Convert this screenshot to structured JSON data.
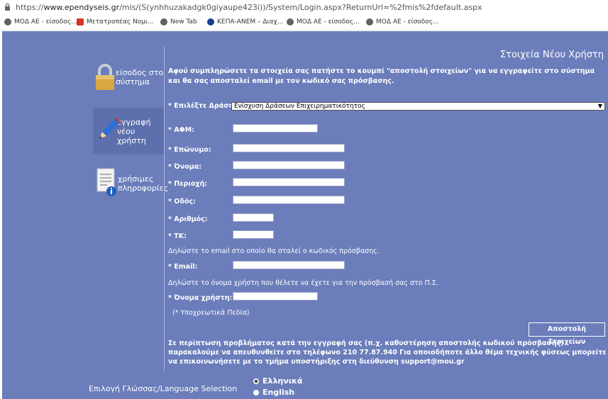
{
  "browser": {
    "url_prefix": "https://",
    "url_domain": "www.ependyseis.gr",
    "url_rest": "/mis/(S(ynhhuzakadgk0giyaupe423i))/System/Login.aspx?ReturnUrl=%2fmis%2fdefault.aspx",
    "bookmarks": [
      {
        "label": "ΜΟΔ ΑΕ - είσοδος...",
        "icon": "globe-icon",
        "color": "#5f6368"
      },
      {
        "label": "Μετατροπέας Νομι...",
        "icon": "app-icon",
        "color": "#d93025"
      },
      {
        "label": "New Tab",
        "icon": "globe-icon",
        "color": "#5f6368"
      },
      {
        "label": "ΚΕΠΑ-ΑΝΕΜ – Διαχ...",
        "icon": "site-icon",
        "color": "#1a3c8f"
      },
      {
        "label": "ΜΟΔ ΑΕ - είσοδος...",
        "icon": "globe-icon",
        "color": "#5f6368"
      },
      {
        "label": "ΜΟΔ ΑΕ - είσοδος...",
        "icon": "globe-icon",
        "color": "#5f6368"
      }
    ]
  },
  "sidebar": {
    "login": {
      "line1": "είσοδος στο",
      "line2": "σύστημα",
      "icon": "padlock-icon"
    },
    "register": {
      "line1": "εγγραφή",
      "line2": "νέου",
      "line3": "χρήστη",
      "icon": "pencil-icon"
    },
    "info": {
      "line1": "χρήσιμες",
      "line2": "πληροφορίες",
      "icon": "info-document-icon"
    }
  },
  "form": {
    "title": "Στοιχεία Νέου Χρήστη",
    "intro": "Αφού συμπληρώσετε τα στοιχεία σας πατήστε το κουμπί \"αποστολή στοιχείων\" για να εγγραφείτε στο σύστημα και θα σας αποσταλεί email με τον κωδικό σας πρόσβασης.",
    "action_label": "* Επιλέξτε Δράση:",
    "action_value": "Ενίσχυση Δράσεων Επιχειρηματικότητος",
    "afm_label": "* ΑΦΜ:",
    "surname_label": "* Επώνυμο:",
    "name_label": "* Όνομα:",
    "region_label": "* Περιοχή:",
    "street_label": "* Οδός:",
    "number_label": "* Αριθμός:",
    "tk_label": "* ΤΚ:",
    "email_note": "Δηλώστε το email στο οποίο θα σταλεί ο κωδικός πρόσβασης.",
    "email_label": "* Email:",
    "username_note": "Δηλώστε το όνομα χρήστη που θέλετε να έχετε για την πρόσβασή σας στο Π.Σ.",
    "username_label": "* Όνομα χρήστη:",
    "required_note": "(*  Υποχρεωτικά Πεδία)",
    "submit_label": "Αποστολή Στοιχείων",
    "help_text": "Σε περίπτωση προβλήματος κατά την εγγραφή σας (π.χ. καθυστέρηση αποστολής κωδικού πρόσβασης) παρακαλούμε να απευθυνθείτε στο τηλέφωνο 210 77.87.940 Για οποιοδήποτε άλλο θέμα τεχνικής φύσεως μπορείτε να επικοινωνήσετε με το τμήμα υποστήριξης στη διεύθυνση support@mou.gr"
  },
  "language": {
    "label": "Επιλογή Γλώσσας/Language Selection",
    "options": [
      {
        "label": "Ελληνικά",
        "selected": true
      },
      {
        "label": "English",
        "selected": false
      }
    ]
  }
}
